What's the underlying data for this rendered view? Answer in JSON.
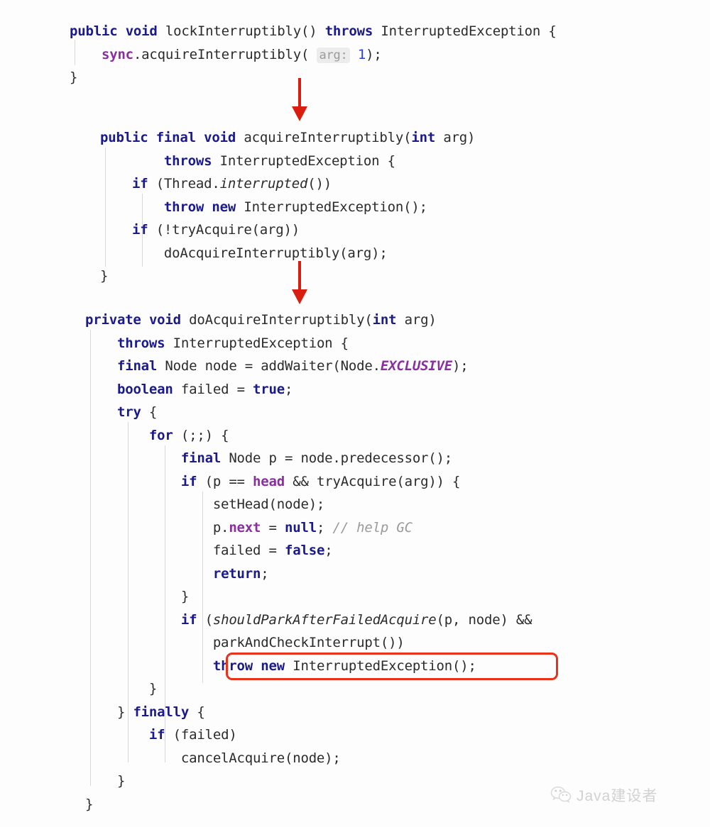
{
  "document": {
    "kind": "code-screenshot",
    "language": "Java",
    "background_color": "#fdfdfd",
    "accent_color": "#e8321a"
  },
  "palette": {
    "keyword": "#1a1a8c",
    "field": "#8a2fa0",
    "plain": "#2b2b2b",
    "number": "#2b3ed6",
    "comment": "#9a9a9a",
    "hint_bg": "#ececec",
    "guide": "#d8d8d8",
    "highlight": "#e8321a",
    "watermark": "#d2d2d2"
  },
  "blocks": [
    {
      "id": "block-lockInterruptibly",
      "lines": [
        [
          {
            "t": "public",
            "c": "kw"
          },
          {
            "t": " ",
            "c": "plain"
          },
          {
            "t": "void",
            "c": "kw"
          },
          {
            "t": " lockInterruptibly() ",
            "c": "plain"
          },
          {
            "t": "throws",
            "c": "kw"
          },
          {
            "t": " InterruptedException {",
            "c": "plain"
          }
        ],
        [
          {
            "t": "    ",
            "c": "plain"
          },
          {
            "t": "sync",
            "c": "field"
          },
          {
            "t": ".acquireInterruptibly( ",
            "c": "plain"
          },
          {
            "t": "arg:",
            "c": "hint"
          },
          {
            "t": " ",
            "c": "plain"
          },
          {
            "t": "1",
            "c": "num"
          },
          {
            "t": ");",
            "c": "plain"
          }
        ],
        [
          {
            "t": "}",
            "c": "plain"
          }
        ]
      ]
    },
    {
      "id": "block-acquireInterruptibly",
      "lines": [
        [
          {
            "t": "public",
            "c": "kw"
          },
          {
            "t": " ",
            "c": "plain"
          },
          {
            "t": "final",
            "c": "kw"
          },
          {
            "t": " ",
            "c": "plain"
          },
          {
            "t": "void",
            "c": "kw"
          },
          {
            "t": " acquireInterruptibly(",
            "c": "plain"
          },
          {
            "t": "int",
            "c": "kw"
          },
          {
            "t": " arg)",
            "c": "plain"
          }
        ],
        [
          {
            "t": "        ",
            "c": "plain"
          },
          {
            "t": "throws",
            "c": "kw"
          },
          {
            "t": " InterruptedException {",
            "c": "plain"
          }
        ],
        [
          {
            "t": "    ",
            "c": "plain"
          },
          {
            "t": "if",
            "c": "kw"
          },
          {
            "t": " (Thread.",
            "c": "plain"
          },
          {
            "t": "interrupted",
            "c": "staticm"
          },
          {
            "t": "())",
            "c": "plain"
          }
        ],
        [
          {
            "t": "        ",
            "c": "plain"
          },
          {
            "t": "throw",
            "c": "kw"
          },
          {
            "t": " ",
            "c": "plain"
          },
          {
            "t": "new",
            "c": "kw"
          },
          {
            "t": " InterruptedException();",
            "c": "plain"
          }
        ],
        [
          {
            "t": "    ",
            "c": "plain"
          },
          {
            "t": "if",
            "c": "kw"
          },
          {
            "t": " (!tryAcquire(arg))",
            "c": "plain"
          }
        ],
        [
          {
            "t": "        doAcquireInterruptibly(arg);",
            "c": "plain"
          }
        ],
        [
          {
            "t": "}",
            "c": "plain"
          }
        ]
      ]
    },
    {
      "id": "block-doAcquireInterruptibly",
      "lines": [
        [
          {
            "t": "private",
            "c": "kw"
          },
          {
            "t": " ",
            "c": "plain"
          },
          {
            "t": "void",
            "c": "kw"
          },
          {
            "t": " doAcquireInterruptibly(",
            "c": "plain"
          },
          {
            "t": "int",
            "c": "kw"
          },
          {
            "t": " arg)",
            "c": "plain"
          }
        ],
        [
          {
            "t": "    ",
            "c": "plain"
          },
          {
            "t": "throws",
            "c": "kw"
          },
          {
            "t": " InterruptedException {",
            "c": "plain"
          }
        ],
        [
          {
            "t": "    ",
            "c": "plain"
          },
          {
            "t": "final",
            "c": "kw"
          },
          {
            "t": " Node node = addWaiter(Node.",
            "c": "plain"
          },
          {
            "t": "EXCLUSIVE",
            "c": "const"
          },
          {
            "t": ");",
            "c": "plain"
          }
        ],
        [
          {
            "t": "    ",
            "c": "plain"
          },
          {
            "t": "boolean",
            "c": "kw"
          },
          {
            "t": " failed = ",
            "c": "plain"
          },
          {
            "t": "true",
            "c": "kw"
          },
          {
            "t": ";",
            "c": "plain"
          }
        ],
        [
          {
            "t": "    ",
            "c": "plain"
          },
          {
            "t": "try",
            "c": "kw"
          },
          {
            "t": " {",
            "c": "plain"
          }
        ],
        [
          {
            "t": "        ",
            "c": "plain"
          },
          {
            "t": "for",
            "c": "kw"
          },
          {
            "t": " (;;) {",
            "c": "plain"
          }
        ],
        [
          {
            "t": "            ",
            "c": "plain"
          },
          {
            "t": "final",
            "c": "kw"
          },
          {
            "t": " Node p = node.predecessor();",
            "c": "plain"
          }
        ],
        [
          {
            "t": "            ",
            "c": "plain"
          },
          {
            "t": "if",
            "c": "kw"
          },
          {
            "t": " (p == ",
            "c": "plain"
          },
          {
            "t": "head",
            "c": "field"
          },
          {
            "t": " && tryAcquire(arg)) {",
            "c": "plain"
          }
        ],
        [
          {
            "t": "                setHead(node);",
            "c": "plain"
          }
        ],
        [
          {
            "t": "                p.",
            "c": "plain"
          },
          {
            "t": "next",
            "c": "field"
          },
          {
            "t": " = ",
            "c": "plain"
          },
          {
            "t": "null",
            "c": "kw"
          },
          {
            "t": "; ",
            "c": "plain"
          },
          {
            "t": "// help GC",
            "c": "cmt"
          }
        ],
        [
          {
            "t": "                failed = ",
            "c": "plain"
          },
          {
            "t": "false",
            "c": "kw"
          },
          {
            "t": ";",
            "c": "plain"
          }
        ],
        [
          {
            "t": "                ",
            "c": "plain"
          },
          {
            "t": "return",
            "c": "kw"
          },
          {
            "t": ";",
            "c": "plain"
          }
        ],
        [
          {
            "t": "            }",
            "c": "plain"
          }
        ],
        [
          {
            "t": "            ",
            "c": "plain"
          },
          {
            "t": "if",
            "c": "kw"
          },
          {
            "t": " (",
            "c": "plain"
          },
          {
            "t": "shouldParkAfterFailedAcquire",
            "c": "staticm"
          },
          {
            "t": "(p, node) &&",
            "c": "plain"
          }
        ],
        [
          {
            "t": "                parkAndCheckInterrupt())",
            "c": "plain"
          }
        ],
        [
          {
            "t": "                ",
            "c": "plain"
          },
          {
            "t": "throw",
            "c": "kw"
          },
          {
            "t": " ",
            "c": "plain"
          },
          {
            "t": "new",
            "c": "kw"
          },
          {
            "t": " InterruptedException();",
            "c": "plain"
          }
        ],
        [
          {
            "t": "        }",
            "c": "plain"
          }
        ],
        [
          {
            "t": "    } ",
            "c": "plain"
          },
          {
            "t": "finally",
            "c": "kw"
          },
          {
            "t": " {",
            "c": "plain"
          }
        ],
        [
          {
            "t": "        ",
            "c": "plain"
          },
          {
            "t": "if",
            "c": "kw"
          },
          {
            "t": " (failed)",
            "c": "plain"
          }
        ],
        [
          {
            "t": "            cancelAcquire(node);",
            "c": "plain"
          }
        ],
        [
          {
            "t": "    }",
            "c": "plain"
          }
        ],
        [
          {
            "t": "}",
            "c": "plain"
          }
        ]
      ]
    }
  ],
  "annotations": {
    "arrows": [
      {
        "name": "arrow-lock-to-acquire",
        "label": "down-arrow"
      },
      {
        "name": "arrow-acquire-to-doacquire",
        "label": "down-arrow"
      }
    ],
    "highlight": {
      "name": "throw-interrupted-exception-highlight",
      "text": "throw new InterruptedException();"
    }
  },
  "watermark": {
    "icon": "wechat-icon",
    "text": "Java建设者"
  }
}
